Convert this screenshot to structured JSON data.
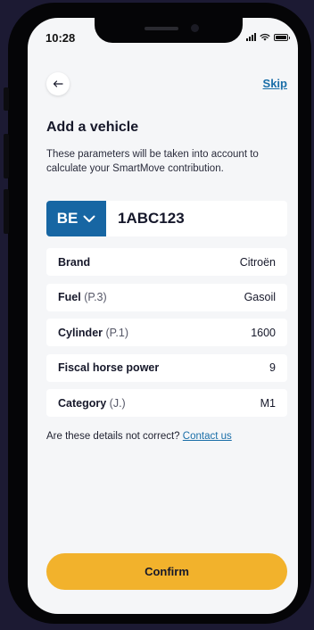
{
  "status_bar": {
    "time": "10:28",
    "icons": [
      "signal-icon",
      "wifi-icon",
      "battery-icon"
    ]
  },
  "header": {
    "back_icon": "arrow-left-icon",
    "skip_label": "Skip"
  },
  "page": {
    "title": "Add a vehicle",
    "description": "These parameters will be taken into account to calculate your SmartMove contribution."
  },
  "plate": {
    "country_code": "BE",
    "country_icon": "chevron-down-icon",
    "number": "1ABC123"
  },
  "details": [
    {
      "label": "Brand",
      "hint": "",
      "value": "Citroën"
    },
    {
      "label": "Fuel",
      "hint": "(P.3)",
      "value": "Gasoil"
    },
    {
      "label": "Cylinder",
      "hint": "(P.1)",
      "value": "1600"
    },
    {
      "label": "Fiscal horse power",
      "hint": "",
      "value": "9"
    },
    {
      "label": "Category",
      "hint": "(J.)",
      "value": "M1"
    }
  ],
  "help": {
    "text": "Are these details not correct?",
    "link_label": "Contact us"
  },
  "confirm_label": "Confirm",
  "colors": {
    "brand_blue": "#1766a3",
    "link_blue": "#1a6ea8",
    "accent_yellow": "#f2b22c",
    "screen_background": "#f5f6f8"
  }
}
